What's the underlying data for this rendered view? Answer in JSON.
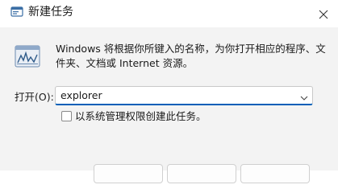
{
  "window": {
    "title": "新建任务",
    "app_icon": "run-dialog-icon",
    "close_icon": "close-icon"
  },
  "content": {
    "big_icon": "task-manager-icon",
    "description": "Windows 将根据你所键入的名称，为你打开相应的程序、文件夹、文档或 Internet 资源。",
    "open_label": "打开(O):",
    "open_value": "explorer",
    "dropdown_icon": "chevron-down-icon",
    "admin_checkbox_label": "以系统管理权限创建此任务。",
    "admin_checkbox_checked": false
  },
  "colors": {
    "accent": "#005fb8",
    "dialog_bg": "#f3f3f3",
    "titlebar_bg": "#ffffff"
  }
}
